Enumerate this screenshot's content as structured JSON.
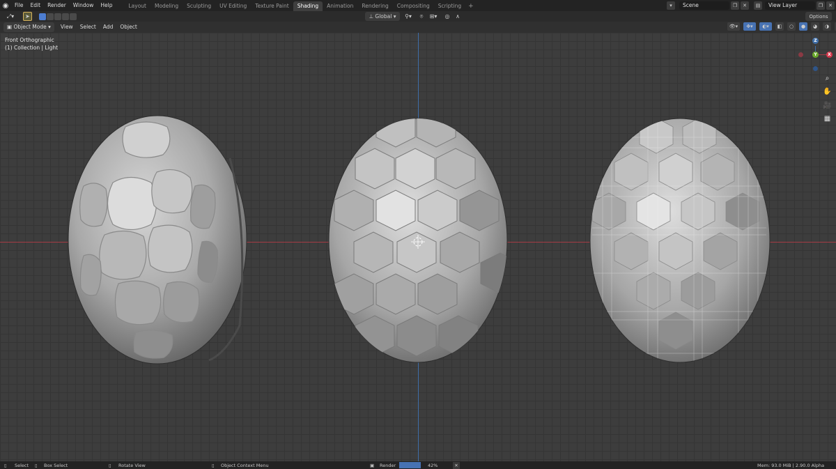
{
  "menu": {
    "items": [
      "File",
      "Edit",
      "Render",
      "Window",
      "Help"
    ]
  },
  "workspaces": {
    "tabs": [
      "Layout",
      "Modeling",
      "Sculpting",
      "UV Editing",
      "Texture Paint",
      "Shading",
      "Animation",
      "Rendering",
      "Compositing",
      "Scripting"
    ],
    "active": "Shading",
    "add_label": "+"
  },
  "scene": {
    "name": "Scene"
  },
  "view_layer": {
    "name": "View Layer"
  },
  "toolbar": {
    "transform_orientation": "Global",
    "options_label": "Options"
  },
  "header": {
    "mode": "Object Mode",
    "menus": [
      "View",
      "Select",
      "Add",
      "Object"
    ]
  },
  "viewport": {
    "view_name": "Front Orthographic",
    "collection_info": "(1) Collection | Light"
  },
  "gizmo": {
    "z_label": "Z",
    "y_label": "Y",
    "x_label": "X"
  },
  "status": {
    "select": "Select",
    "box_select": "Box Select",
    "rotate_view": "Rotate View",
    "context_menu": "Object Context Menu",
    "render_label": "Render",
    "render_progress": "42%",
    "render_fraction": 0.42,
    "memory": "Mem: 93.0 MiB | 2.90.0 Alpha"
  },
  "colors": {
    "x_axis": "#a53b45",
    "z_axis": "#3f6ea8",
    "active_tab": "#3f3f3f",
    "progress": "#4772b3"
  }
}
